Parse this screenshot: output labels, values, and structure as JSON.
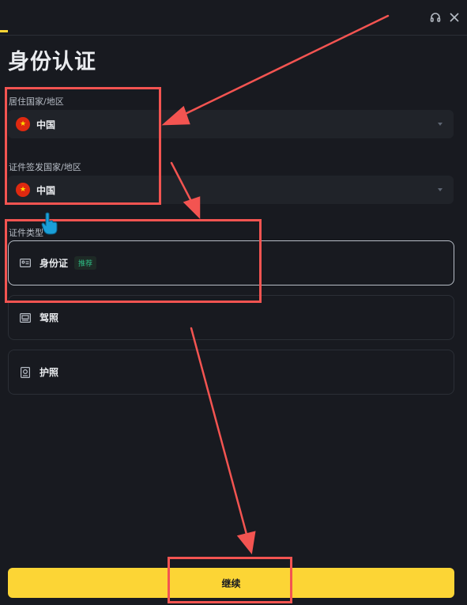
{
  "header": {
    "support_icon": "headset-icon",
    "close_icon": "close-icon"
  },
  "title": "身份认证",
  "residence": {
    "label": "居住国家/地区",
    "value": "中国",
    "flag_icon": "china-flag-icon"
  },
  "issuing": {
    "label": "证件签发国家/地区",
    "value": "中国",
    "flag_icon": "china-flag-icon"
  },
  "doc_type": {
    "label": "证件类型",
    "options": [
      {
        "label": "身份证",
        "badge": "推荐",
        "icon": "id-card-icon",
        "selected": true
      },
      {
        "label": "驾照",
        "icon": "driver-license-icon",
        "selected": false
      },
      {
        "label": "护照",
        "icon": "passport-icon",
        "selected": false
      }
    ]
  },
  "continue_label": "继续",
  "colors": {
    "background": "#181a20",
    "field_bg": "#202329",
    "accent": "#fcd535",
    "recommend_green": "#2ebd85",
    "annotation_red": "#f35451"
  }
}
